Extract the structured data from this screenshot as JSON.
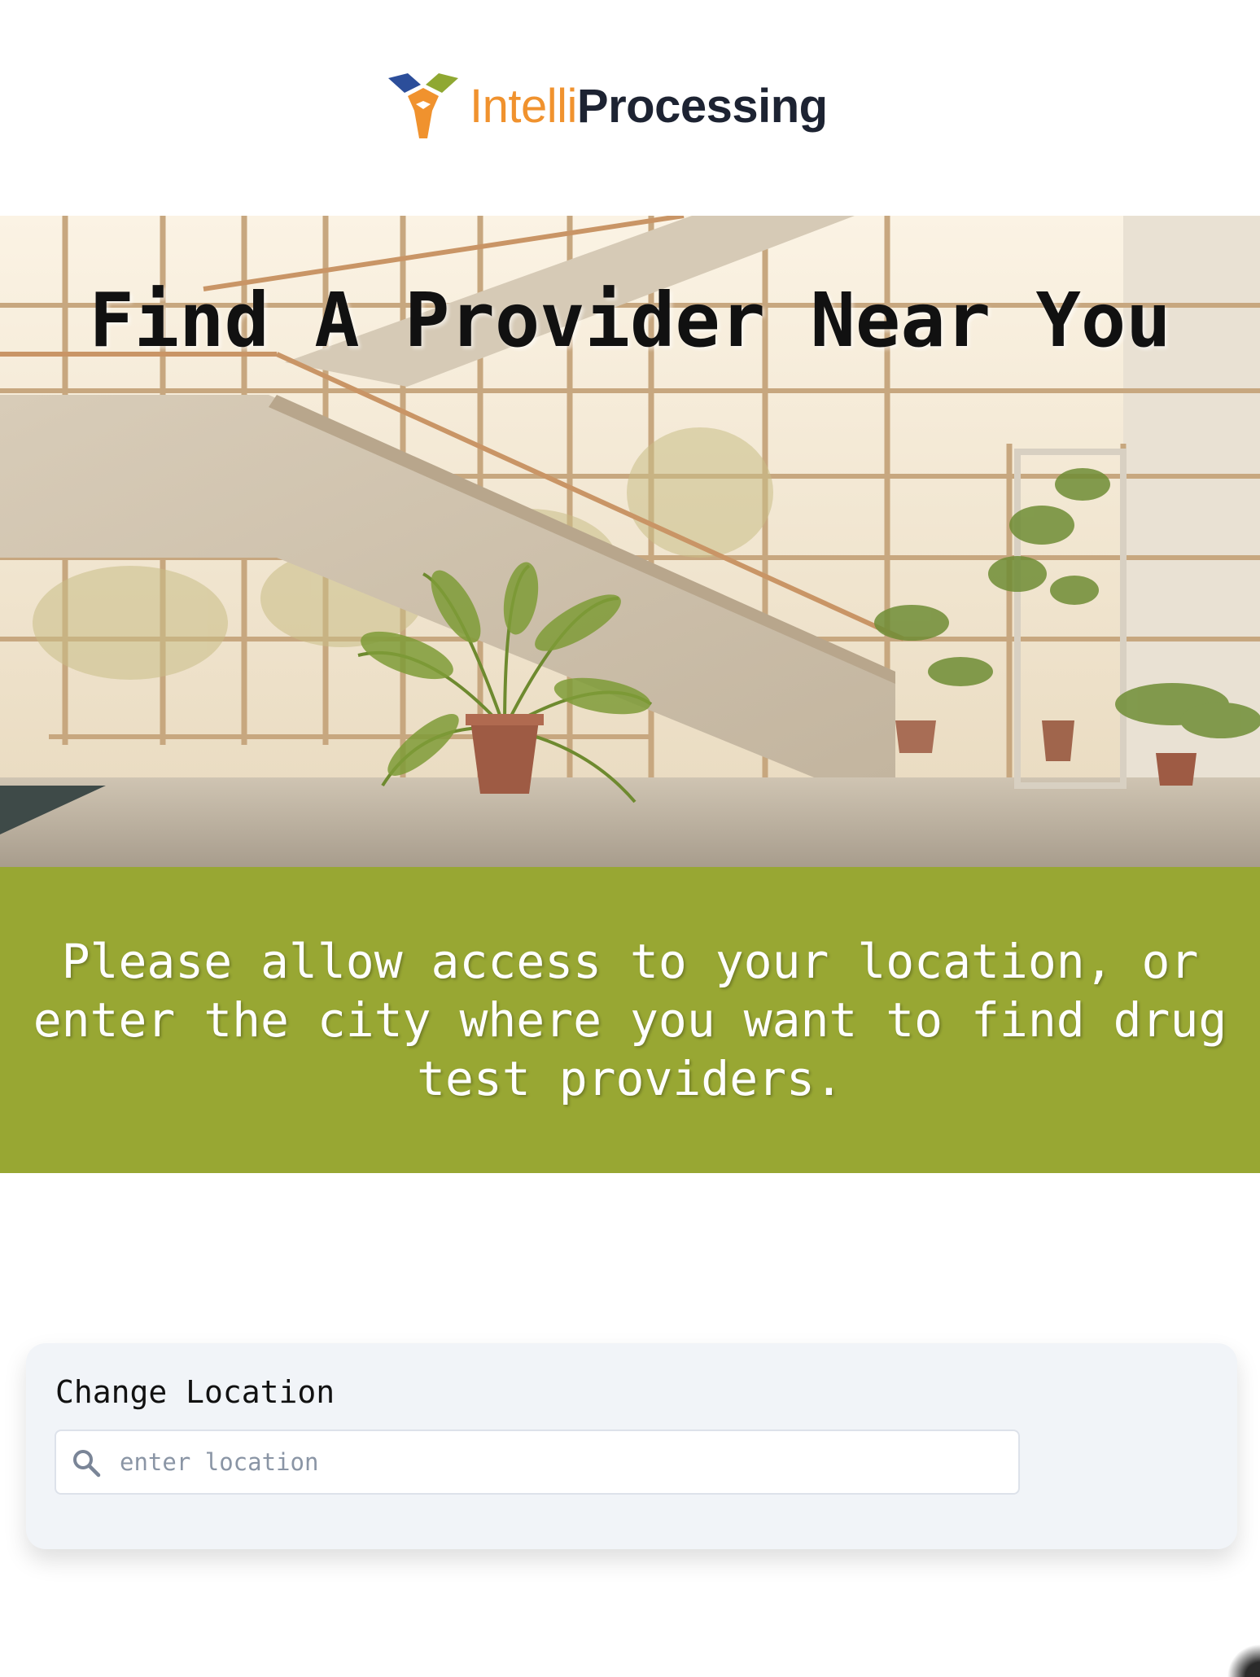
{
  "brand": {
    "name_part1": "Intelli",
    "name_part2": "Processing",
    "logo_icon": "cube-logo-icon",
    "colors": {
      "orange": "#F0922E",
      "blue": "#2C4E9A",
      "green": "#8FA832",
      "dark": "#1d2332"
    }
  },
  "hero": {
    "title": "Find A Provider Near You",
    "background": "interior-staircase-with-plants-photo"
  },
  "message": {
    "text": "Please allow access to your location, or enter the city where you want to find drug test providers.",
    "band_color": "#98A733"
  },
  "location": {
    "label": "Change Location",
    "placeholder": "enter location",
    "value": "",
    "icon": "search-icon"
  }
}
